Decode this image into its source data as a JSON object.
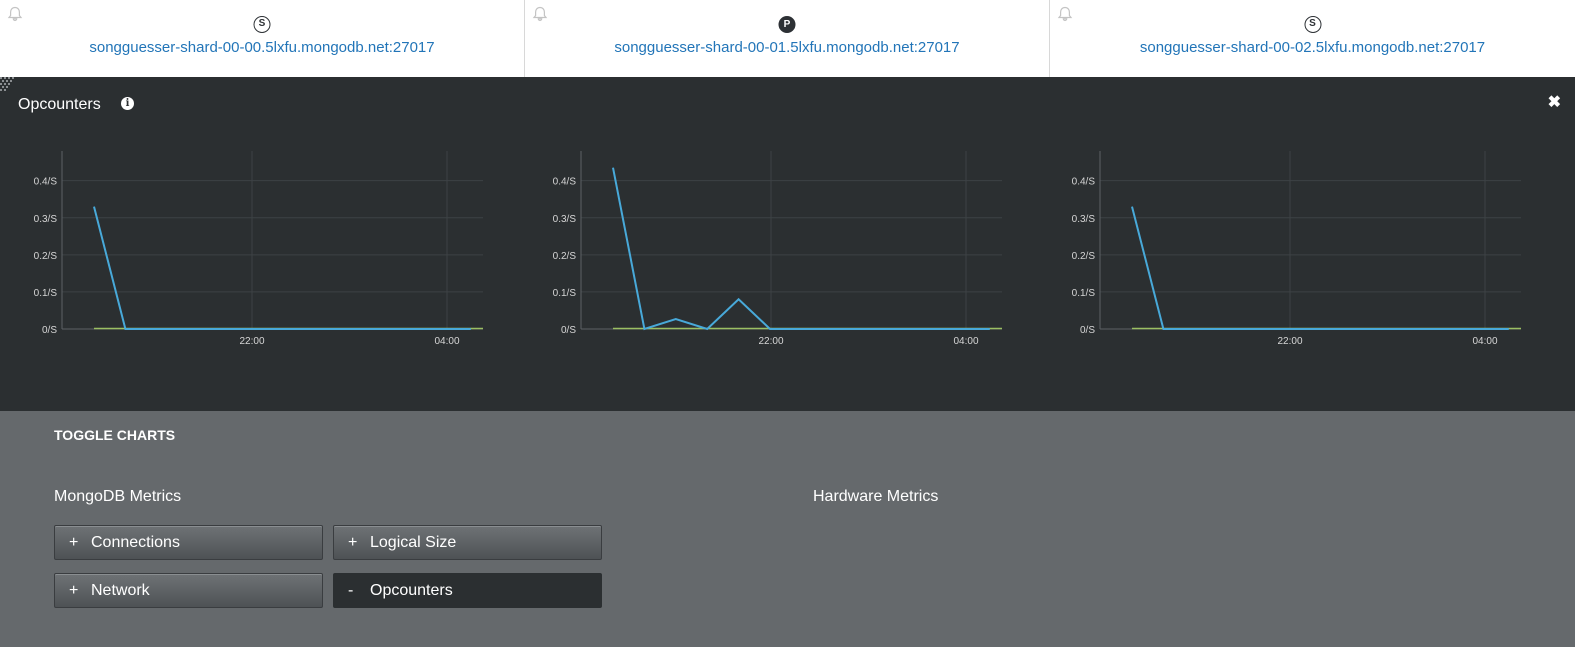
{
  "hosts": [
    {
      "badge": "S",
      "role": "secondary",
      "hostname": "songguesser-shard-00-00.5lxfu.mongodb.net:27017"
    },
    {
      "badge": "P",
      "role": "primary",
      "hostname": "songguesser-shard-00-01.5lxfu.mongodb.net:27017"
    },
    {
      "badge": "S",
      "role": "secondary",
      "hostname": "songguesser-shard-00-02.5lxfu.mongodb.net:27017"
    }
  ],
  "panel": {
    "title": "Opcounters"
  },
  "colors": {
    "line_primary": "#48a9d9",
    "line_secondary": "#9bbf63",
    "grid": "#3d4245",
    "axis": "#5c6165"
  },
  "chart_data": [
    {
      "type": "line",
      "title": "",
      "y_ticks": [
        "0/S",
        "0.1/S",
        "0.2/S",
        "0.3/S",
        "0.4/S"
      ],
      "x_ticks": [
        "22:00",
        "04:00"
      ],
      "ylim": [
        0,
        0.48
      ],
      "series": [
        {
          "points": [
            [
              0,
              0.33
            ],
            [
              1,
              0
            ],
            [
              2,
              0
            ],
            [
              3,
              0
            ],
            [
              4,
              0
            ],
            [
              5,
              0
            ],
            [
              6,
              0
            ],
            [
              7,
              0
            ],
            [
              8,
              0
            ],
            [
              9,
              0
            ],
            [
              10,
              0
            ],
            [
              11,
              0
            ],
            [
              12,
              0
            ]
          ]
        }
      ]
    },
    {
      "type": "line",
      "title": "",
      "y_ticks": [
        "0/S",
        "0.1/S",
        "0.2/S",
        "0.3/S",
        "0.4/S"
      ],
      "x_ticks": [
        "22:00",
        "04:00"
      ],
      "ylim": [
        0,
        0.48
      ],
      "series": [
        {
          "points": [
            [
              0,
              0.435
            ],
            [
              1,
              0
            ],
            [
              2,
              0.027
            ],
            [
              3,
              0
            ],
            [
              4,
              0.08
            ],
            [
              5,
              0
            ],
            [
              6,
              0
            ],
            [
              7,
              0
            ],
            [
              8,
              0
            ],
            [
              9,
              0
            ],
            [
              10,
              0
            ],
            [
              11,
              0
            ],
            [
              12,
              0
            ]
          ]
        }
      ]
    },
    {
      "type": "line",
      "title": "",
      "y_ticks": [
        "0/S",
        "0.1/S",
        "0.2/S",
        "0.3/S",
        "0.4/S"
      ],
      "x_ticks": [
        "22:00",
        "04:00"
      ],
      "ylim": [
        0,
        0.48
      ],
      "series": [
        {
          "points": [
            [
              0,
              0.33
            ],
            [
              1,
              0
            ],
            [
              2,
              0
            ],
            [
              3,
              0
            ],
            [
              4,
              0
            ],
            [
              5,
              0
            ],
            [
              6,
              0
            ],
            [
              7,
              0
            ],
            [
              8,
              0
            ],
            [
              9,
              0
            ],
            [
              10,
              0
            ],
            [
              11,
              0
            ],
            [
              12,
              0
            ]
          ]
        }
      ]
    }
  ],
  "toggle": {
    "title": "TOGGLE CHARTS",
    "mongodb_label": "MongoDB Metrics",
    "hardware_label": "Hardware Metrics",
    "buttons": [
      {
        "sign": "+",
        "label": "Connections",
        "active": false
      },
      {
        "sign": "+",
        "label": "Logical Size",
        "active": false
      },
      {
        "sign": "+",
        "label": "Network",
        "active": false
      },
      {
        "sign": "-",
        "label": "Opcounters",
        "active": true
      }
    ]
  }
}
